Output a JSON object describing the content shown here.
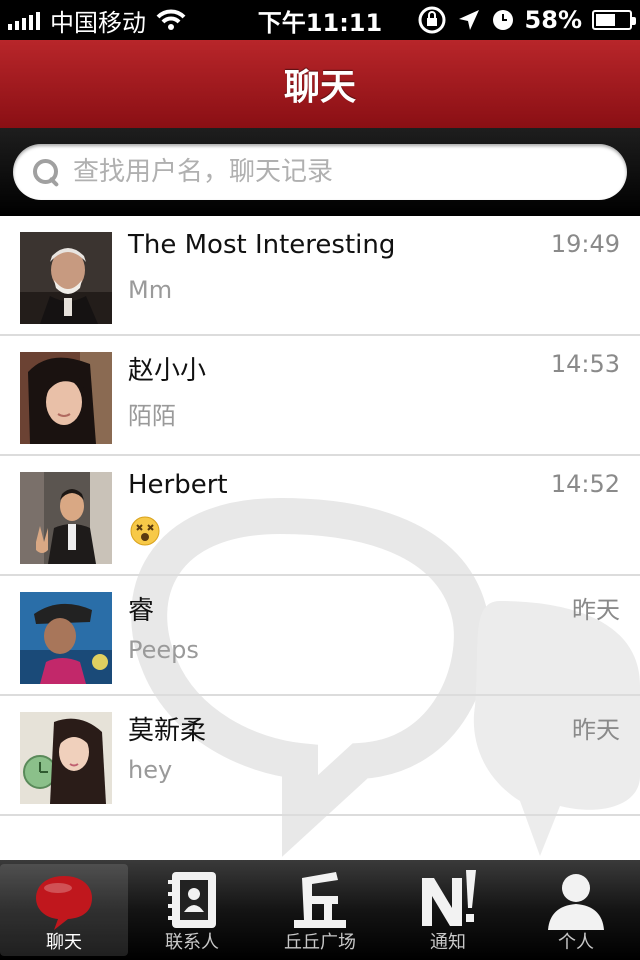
{
  "status_bar": {
    "carrier": "中国移动",
    "time": "下午11:11",
    "battery": "58%",
    "battery_level": 0.58
  },
  "nav": {
    "title": "聊天"
  },
  "search": {
    "placeholder": "查找用户名，聊天记录"
  },
  "chats": [
    {
      "name": "The Most Interesting",
      "time": "19:49",
      "preview": "Mm"
    },
    {
      "name": "赵小小",
      "time": "14:53",
      "preview": "陌陌"
    },
    {
      "name": "Herbert",
      "time": "14:52",
      "preview": "",
      "preview_icon": "dizzy-face-emoji-icon"
    },
    {
      "name": "睿",
      "time": "昨天",
      "preview": "Peeps"
    },
    {
      "name": "莫新柔",
      "time": "昨天",
      "preview": "hey"
    }
  ],
  "tabs": [
    {
      "label": "聊天",
      "icon": "chat-bubble-icon",
      "active": true
    },
    {
      "label": "联系人",
      "icon": "contacts-book-icon",
      "active": false
    },
    {
      "label": "丘丘广场",
      "icon": "plaza-qiu-icon",
      "active": false
    },
    {
      "label": "通知",
      "icon": "notification-n-icon",
      "active": false
    },
    {
      "label": "个人",
      "icon": "person-icon",
      "active": false
    }
  ],
  "colors": {
    "nav_red": "#a51c21",
    "tab_bar": "#141414",
    "active_chat_icon": "#c0171d"
  }
}
